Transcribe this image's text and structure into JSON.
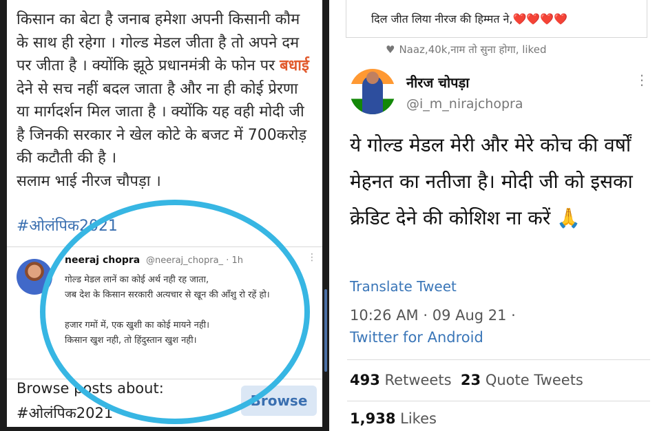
{
  "left": {
    "post_text_1": "किसान का बेटा है जनाब हमेशा अपनी किसानी कौम के साथ ही रहेगा । गोल्ड मेडल जीता है तो अपने दम पर जीता है । क्योंकि झूठे प्रधानमंत्री के फोन पर ",
    "post_highlight": "बधाई",
    "post_text_2": " देने से सच नहीं बदल जाता है और ना ही कोई प्रेरणा या मार्गदर्शन मिल जाता है । क्योंकि यह वही मोदी जी है जिनकी सरकार ने खेल कोटे के बजट में 700करोड़ की कटौती की है ।",
    "salute": "सलाम भाई नीरज चौपड़ा ।",
    "hashtag": "#ओलंपिक2021",
    "embedded": {
      "name": "neeraj chopra",
      "handle": "@neeraj_chopra_ · 1h",
      "line1": "गोल्ड मेडल लानें का कोई अर्थ नही रह जाता,",
      "line2": "जब देश के किसान सरकारी अत्यचार से खून की आँशु रो रहें हो।",
      "line3": "हजार गमों में, एक खुशी का कोई मायने नही।",
      "line4": "किसान खुश नही, तो हिंदुस्तान खुश नही।"
    },
    "browse_label": "Browse posts about:",
    "browse_tag": "#ओलंपिक2021",
    "browse_button": "Browse",
    "circle_color": "#37b6e3"
  },
  "right": {
    "quote_text": "दिल जीत लिया नीरज की हिम्मत ने,❤️❤️❤️❤️",
    "liked_text": "Naaz,40k,नाम तो सुना होगा, liked",
    "name": "नीरज चोपड़ा",
    "handle": "@i_m_nirajchopra",
    "tweet": "ये गोल्ड मेडल मेरी और मेरे कोच की वर्षों मेहनत का नतीजा है। मोदी जी को इसका क्रेडिट देने की कोशिश ना करें 🙏",
    "translate": "Translate Tweet",
    "time": "10:26 AM · 09 Aug 21 ·",
    "source": "Twitter for Android",
    "retweets_count": "493",
    "retweets_label": "Retweets",
    "quotes_count": "23",
    "quotes_label": "Quote Tweets",
    "likes_count": "1,938",
    "likes_label": "Likes",
    "link_color": "#3a76b8"
  }
}
